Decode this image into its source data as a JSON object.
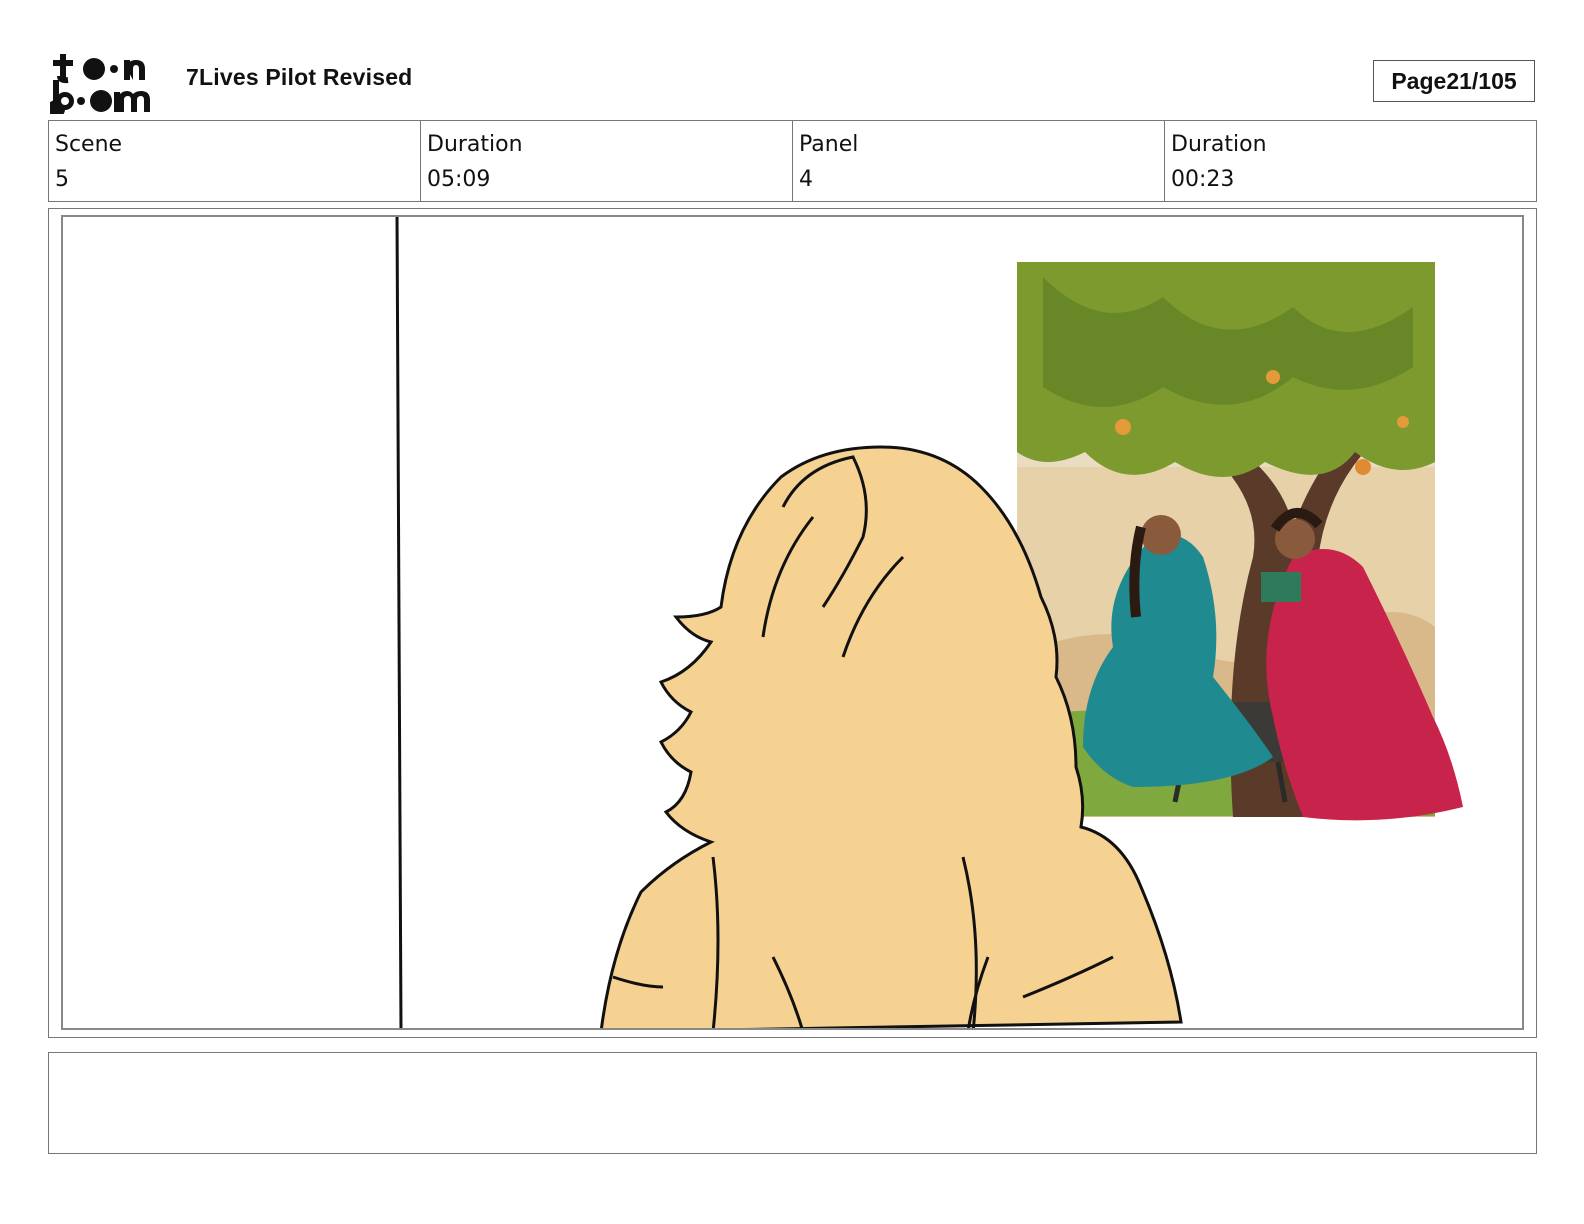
{
  "header": {
    "logo_alt": "toon boom",
    "project_title": "7Lives Pilot Revised",
    "page_label": "Page",
    "page_value": "21/105"
  },
  "info": {
    "scene_label": "Scene",
    "scene_value": "5",
    "scene_duration_label": "Duration",
    "scene_duration_value": "05:09",
    "panel_label": "Panel",
    "panel_value": "4",
    "panel_duration_label": "Duration",
    "panel_duration_value": "00:23"
  },
  "panel": {
    "description": "",
    "colors": {
      "hair": "#f5d291",
      "line": "#111111",
      "sari_teal": "#1f8a8f",
      "sari_red": "#c8234a",
      "leaves": "#7d9a2f",
      "trunk": "#5a3b2a"
    }
  },
  "notes": {
    "text": ""
  }
}
